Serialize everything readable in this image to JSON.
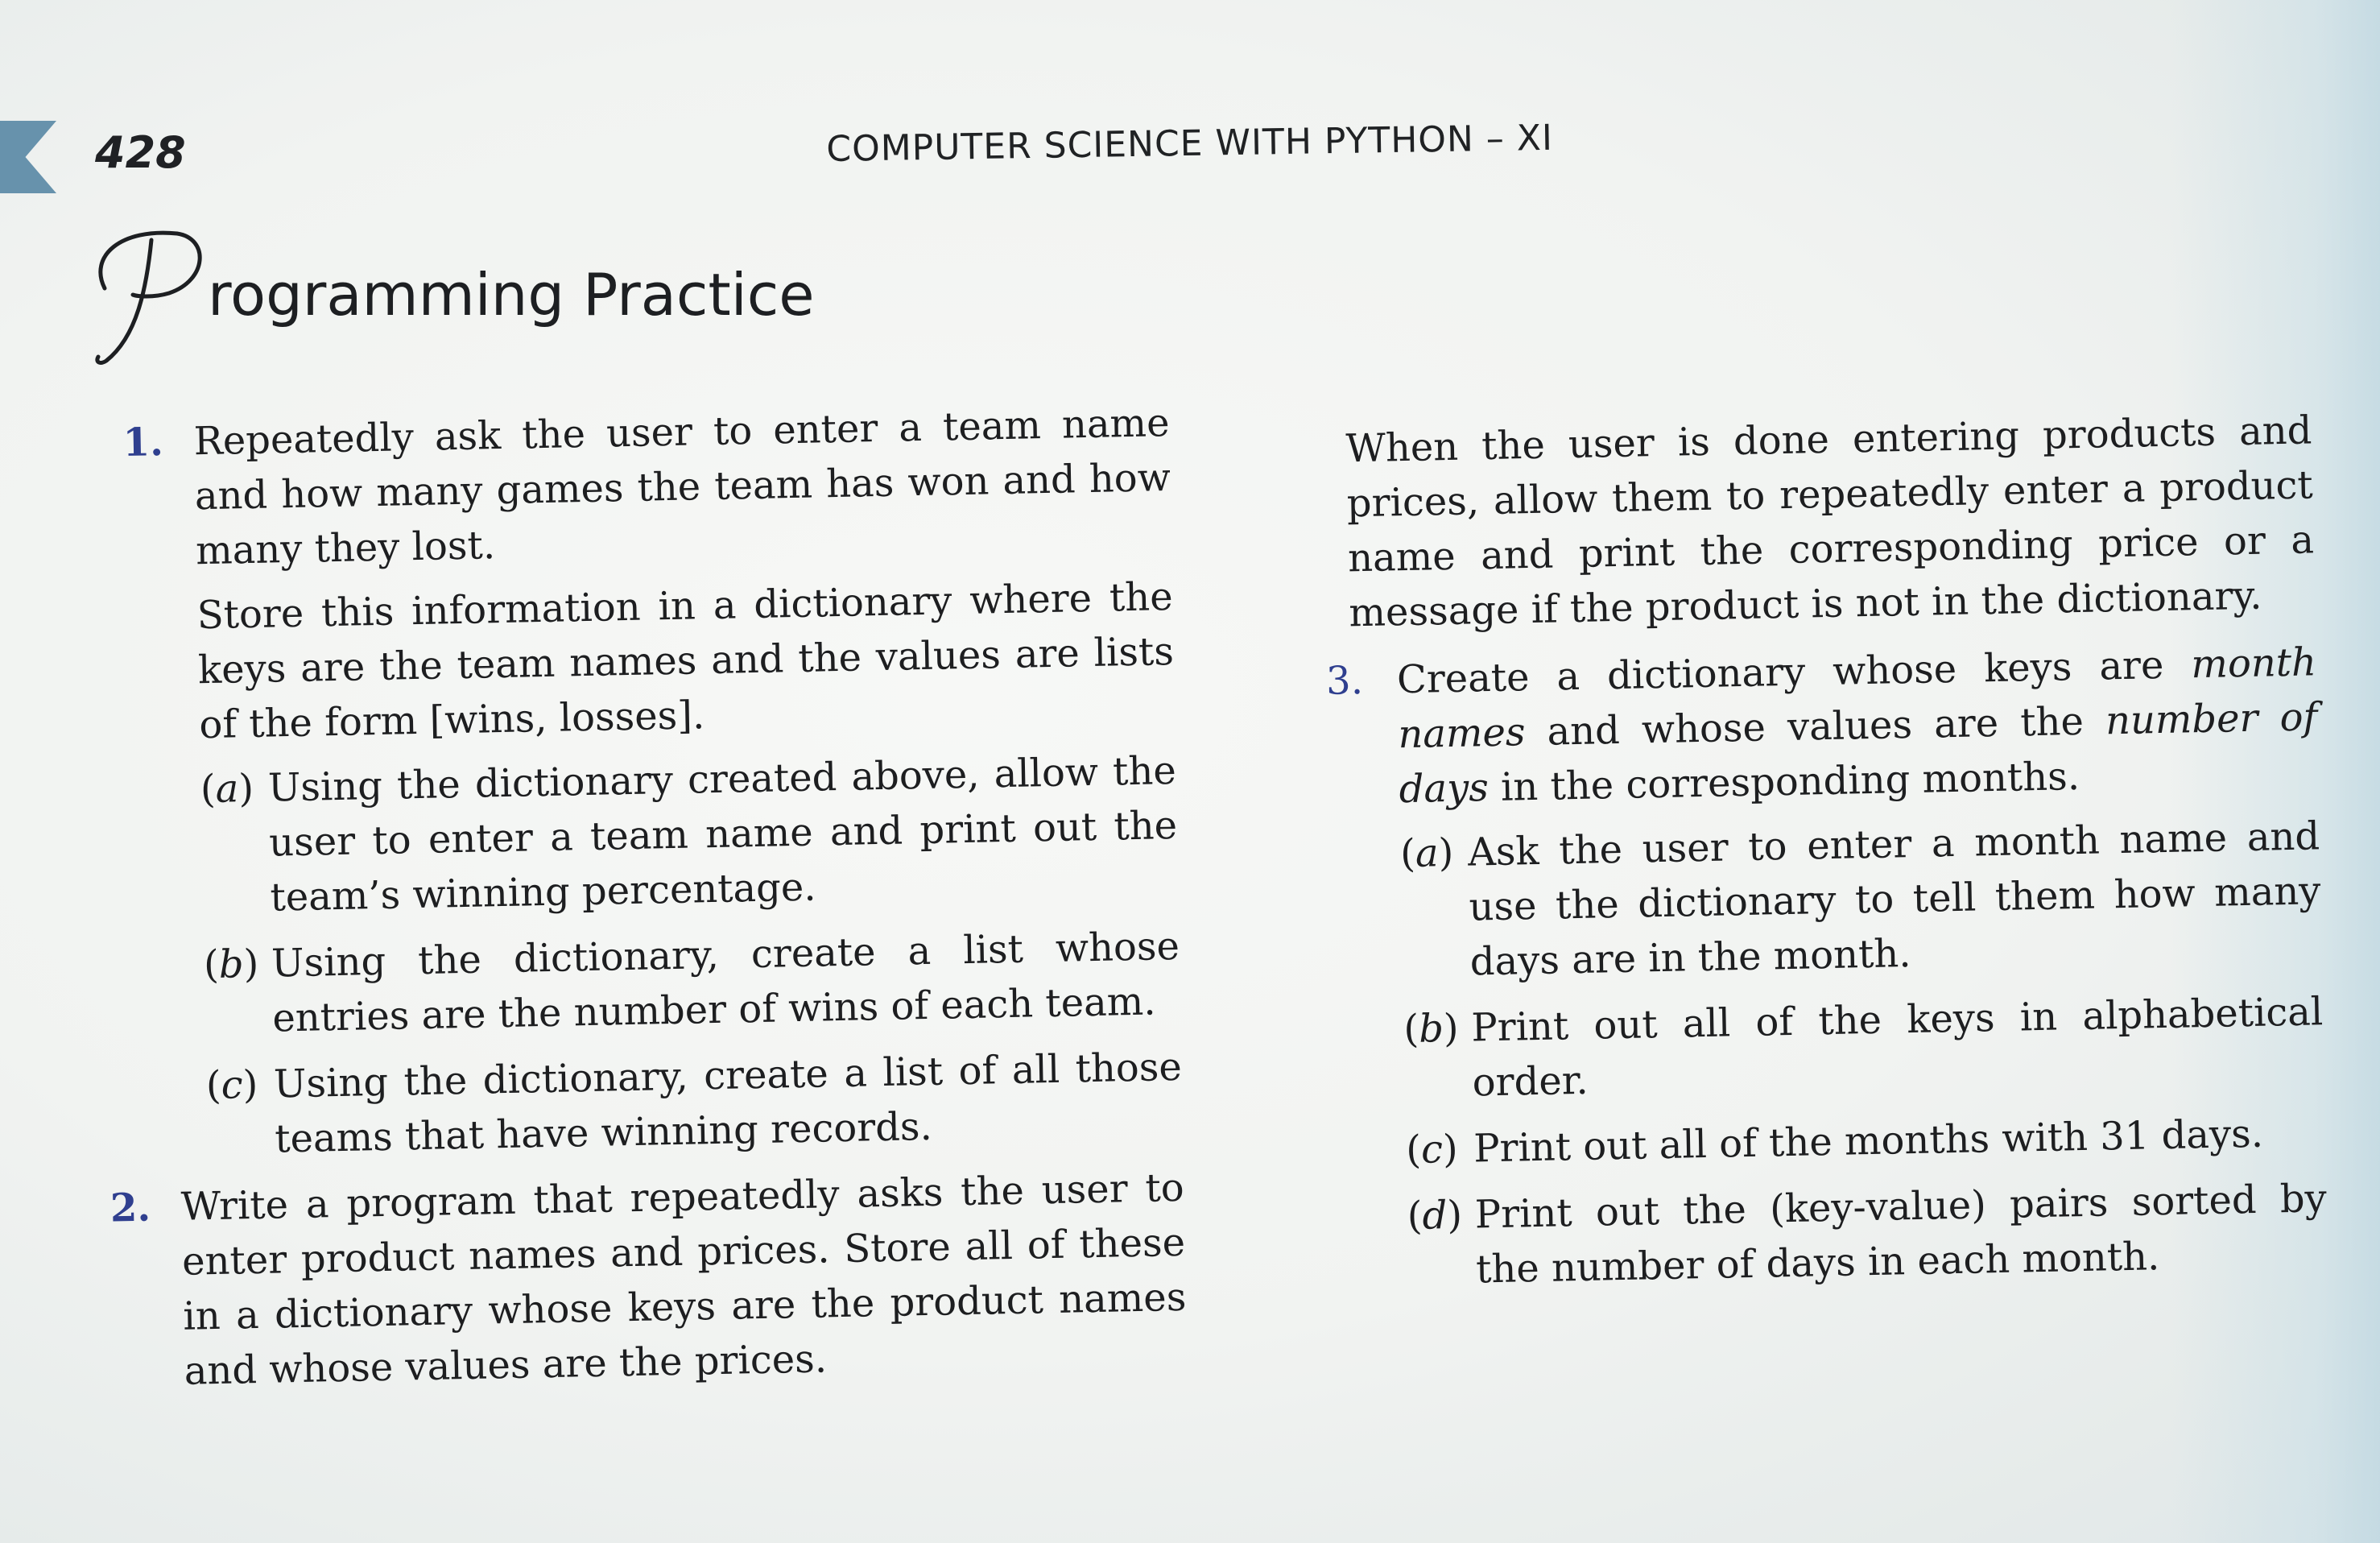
{
  "header": {
    "page_number": "428",
    "running_title": "COMPUTER SCIENCE WITH PYTHON – XI"
  },
  "section": {
    "title_rest": "rogramming Practice"
  },
  "questions": [
    {
      "number": "1.",
      "paragraphs": [
        "Repeatedly ask the user to enter a team name and how many games the team has won and how many they lost.",
        "Store this information in a dictionary where the keys are the team names and the values are lists of the form [wins, losses]."
      ],
      "parts": [
        {
          "label": "a",
          "text": "Using the dictionary created above, allow the user to enter a team name and print out the team’s winning percentage."
        },
        {
          "label": "b",
          "text": "Using the dictionary, create a list whose entries are the number of wins of each team."
        },
        {
          "label": "c",
          "text": "Using the dictionary, create a list of all those teams that have winning records."
        }
      ]
    },
    {
      "number": "2.",
      "paragraphs": [
        "Write a program that repeatedly asks the user to enter product names and prices. Store all of these in a dictionary whose keys are the product names and whose values are the prices."
      ],
      "continuation": "When the user is done entering products and prices, allow them to repeatedly enter a product name and print the corresponding price or a message if the product is not in the dictionary."
    },
    {
      "number": "3.",
      "intro_1": "Create a dictionary whose keys are ",
      "intro_em_1": "month names",
      "intro_2": " and whose values are the ",
      "intro_em_2": "number of days",
      "intro_3": " in the corresponding months.",
      "parts": [
        {
          "label": "a",
          "text": "Ask the user to enter a month name and use the dictionary to tell them how many days are in the month."
        },
        {
          "label": "b",
          "text": "Print out all of the keys in alphabetical order."
        },
        {
          "label": "c",
          "text": "Print out all of the months with 31 days."
        },
        {
          "label": "d",
          "text": "Print out the (key-value) pairs sorted by the number of days in each month."
        }
      ]
    }
  ]
}
